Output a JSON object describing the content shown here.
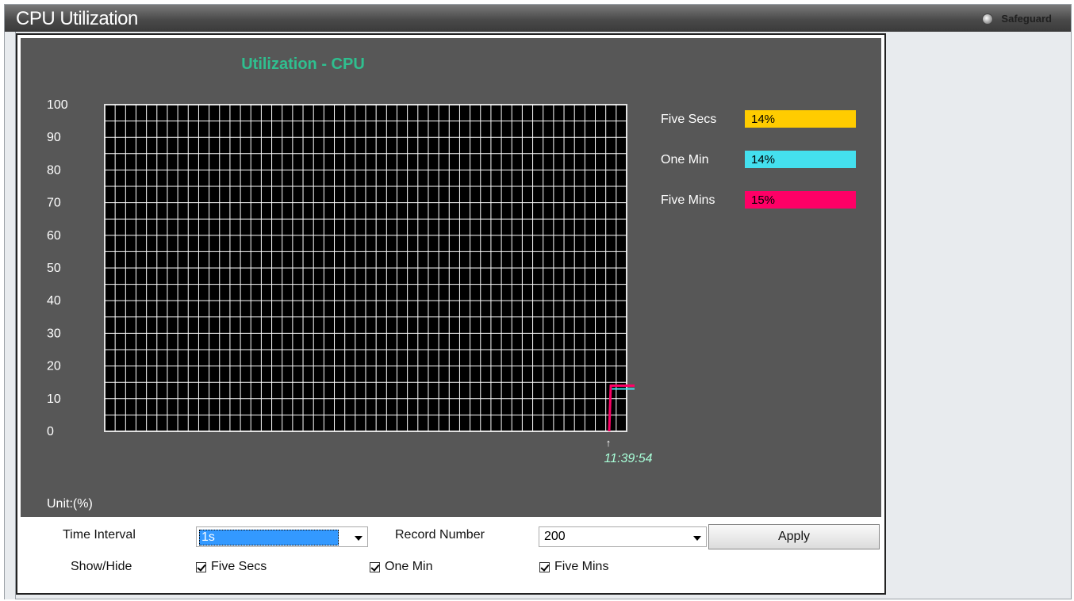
{
  "window": {
    "title": "CPU Utilization",
    "safeguard_label": "Safeguard"
  },
  "chart_data": {
    "type": "line",
    "title": "Utilization - CPU",
    "ylabel": "Unit:(%)",
    "ylim": [
      0,
      100
    ],
    "y_ticks": [
      "100",
      "90",
      "80",
      "70",
      "60",
      "50",
      "40",
      "30",
      "20",
      "10",
      "0"
    ],
    "x_marker_label": "11:39:54",
    "grid": true,
    "legend_position": "right",
    "series": [
      {
        "name": "Five Secs",
        "value_label": "14%",
        "color": "#ffcc00",
        "values": [
          0,
          14
        ]
      },
      {
        "name": "One Min",
        "value_label": "14%",
        "color": "#44e0ee",
        "values": [
          0,
          14,
          13
        ]
      },
      {
        "name": "Five Mins",
        "value_label": "15%",
        "color": "#ff0066",
        "values": [
          0,
          14,
          14
        ]
      }
    ]
  },
  "controls": {
    "time_interval_label": "Time Interval",
    "time_interval_value": "1s",
    "record_number_label": "Record Number",
    "record_number_value": "200",
    "apply_label": "Apply",
    "show_hide_label": "Show/Hide",
    "cb_five_secs": "Five Secs",
    "cb_one_min": "One Min",
    "cb_five_mins": "Five Mins"
  }
}
